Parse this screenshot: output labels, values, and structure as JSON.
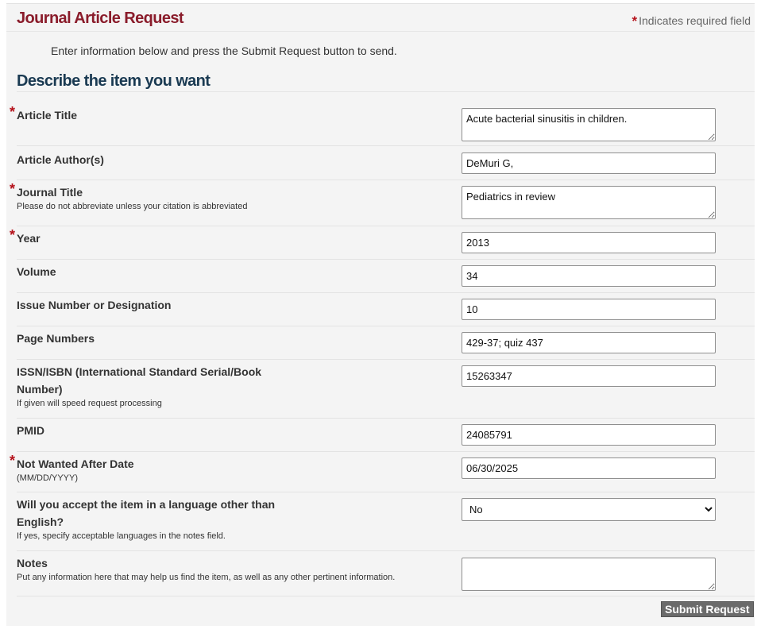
{
  "header": {
    "title": "Journal Article Request",
    "required_note_star": "*",
    "required_note": "Indicates required field"
  },
  "intro": "Enter information below and press the Submit Request button to send.",
  "section_title": "Describe the item you want",
  "fields": {
    "article_title": {
      "label": "Article Title",
      "required": "*",
      "value": "Acute bacterial sinusitis in children."
    },
    "article_authors": {
      "label": "Article Author(s)",
      "value": "DeMuri G,"
    },
    "journal_title": {
      "label": "Journal Title",
      "required": "*",
      "hint": "Please do not abbreviate unless your citation is abbreviated",
      "value": "Pediatrics in review"
    },
    "year": {
      "label": "Year",
      "required": "*",
      "value": "2013"
    },
    "volume": {
      "label": "Volume",
      "value": "34"
    },
    "issue": {
      "label": "Issue Number or Designation",
      "value": "10"
    },
    "pages": {
      "label": "Page Numbers",
      "value": "429-37; quiz 437"
    },
    "issn": {
      "label_line1": "ISSN/ISBN (International Standard Serial/Book",
      "label_line2": "Number)",
      "hint": "If given will speed request processing",
      "value": "15263347"
    },
    "pmid": {
      "label": "PMID",
      "value": "24085791"
    },
    "not_wanted_after": {
      "label": "Not Wanted After Date",
      "required": "*",
      "hint": "(MM/DD/YYYY)",
      "value": "06/30/2025"
    },
    "language": {
      "label_line1": "Will you accept the item in a language other than",
      "label_line2": "English?",
      "hint": "If yes, specify acceptable languages in the notes field.",
      "selected": "No"
    },
    "notes": {
      "label": "Notes",
      "hint": "Put any information here that may help us find the item, as well as any other pertinent information.",
      "value": ""
    }
  },
  "submit_label": "Submit Request"
}
